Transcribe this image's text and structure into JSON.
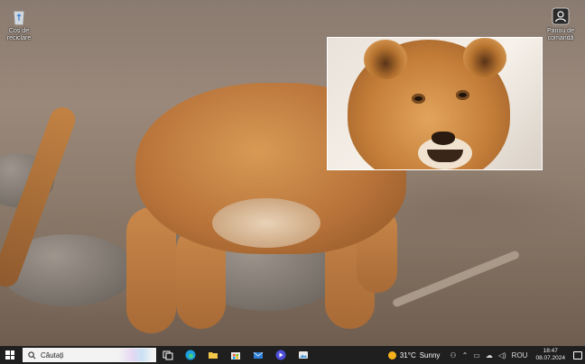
{
  "desktop": {
    "icons": [
      {
        "label": "Coș de reciclare",
        "icon": "recycle-bin-icon"
      },
      {
        "label": "Panou de comandă",
        "icon": "control-panel-icon"
      }
    ]
  },
  "viewer": {
    "image": "lion-cub-face-photo"
  },
  "taskbar": {
    "search_placeholder": "Căutați",
    "apps": [
      {
        "name": "task-view-icon",
        "color": "#ffffff"
      },
      {
        "name": "edge-icon",
        "color": "#1e9de0"
      },
      {
        "name": "file-explorer-icon",
        "color": "#f3c74a"
      },
      {
        "name": "store-icon",
        "color": "#3a96dd"
      },
      {
        "name": "mail-icon",
        "color": "#2f7fd6"
      },
      {
        "name": "media-player-icon",
        "color": "#4f4fd9"
      },
      {
        "name": "photos-icon",
        "color": "#4a9bd9"
      }
    ],
    "weather": {
      "temp": "31°C",
      "condition": "Sunny"
    },
    "language": "ROU",
    "time": "18:47",
    "date": "08.07.2024"
  }
}
